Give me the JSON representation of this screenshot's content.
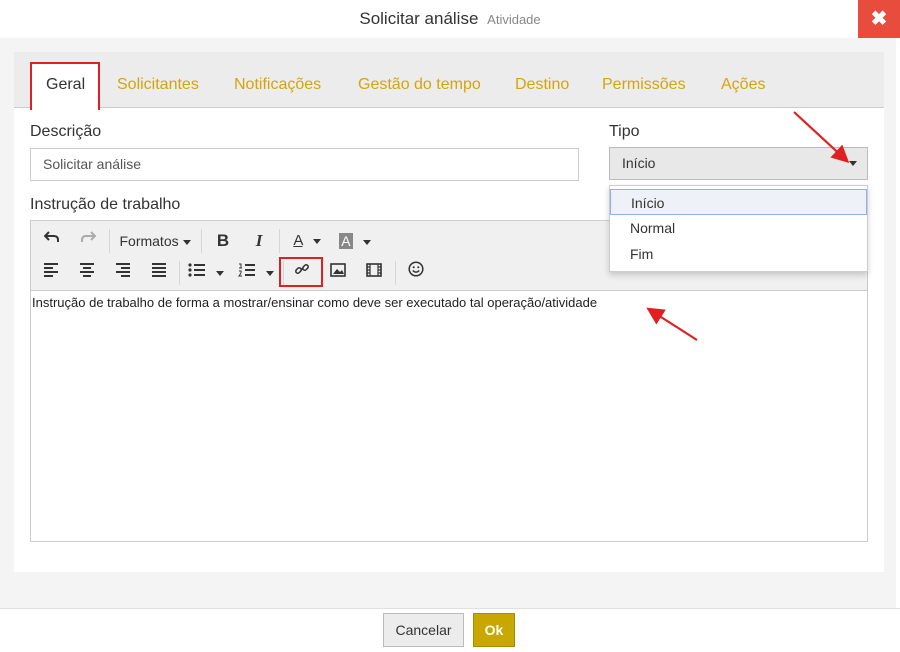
{
  "dialog": {
    "title": "Solicitar análise",
    "subtitle": "Atividade",
    "close_icon": "close-icon"
  },
  "tabs": [
    {
      "label": "Geral",
      "active": true
    },
    {
      "label": "Solicitantes",
      "active": false
    },
    {
      "label": "Notificações",
      "active": false
    },
    {
      "label": "Gestão do tempo",
      "active": false
    },
    {
      "label": "Destino",
      "active": false
    },
    {
      "label": "Permissões",
      "active": false
    },
    {
      "label": "Ações",
      "active": false
    }
  ],
  "form": {
    "descricao_label": "Descrição",
    "descricao_value": "Solicitar análise",
    "tipo_label": "Tipo",
    "tipo_value": "Início",
    "tipo_options": [
      "Início",
      "Normal",
      "Fim"
    ],
    "instrucao_label": "Instrução de trabalho"
  },
  "editor": {
    "formats_label": "Formatos",
    "bold_label": "B",
    "italic_label": "I",
    "font_color_label": "A",
    "bg_color_label": "A",
    "content": "Instrução de trabalho de forma a mostrar/ensinar como deve ser executado tal operação/atividade"
  },
  "footer": {
    "cancel_label": "Cancelar",
    "ok_label": "Ok"
  },
  "colors": {
    "accent": "#d4a410",
    "ok_button": "#c8a800",
    "close_button": "#e74c3c",
    "annotation": "#e02020"
  }
}
